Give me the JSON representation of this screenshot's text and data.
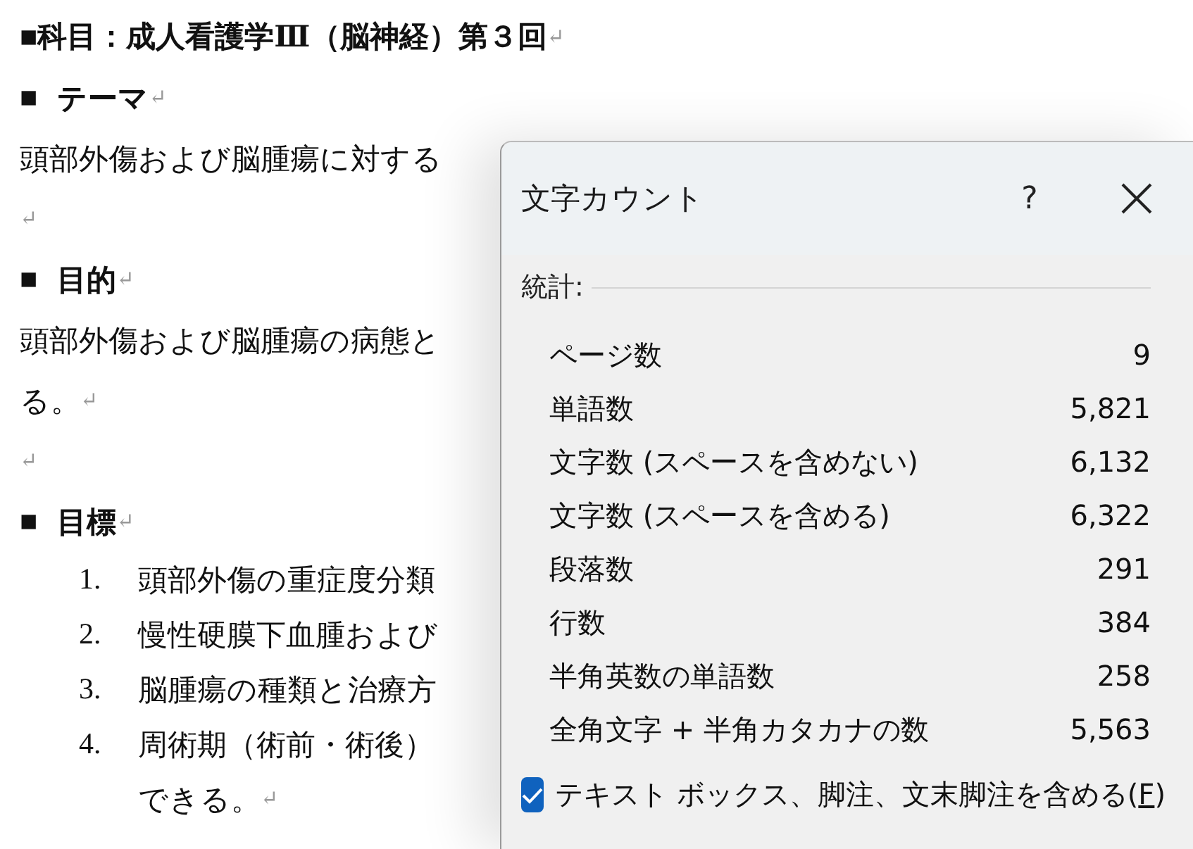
{
  "document": {
    "blocks": [
      {
        "kind": "title",
        "text": "■科目：成人看護学Ⅲ（脳神経）第３回",
        "end_mark": "↵"
      },
      {
        "kind": "heading",
        "bullet": "■",
        "text": "テーマ",
        "end_mark": "↵"
      },
      {
        "kind": "body",
        "text": "頭部外傷および脳腫瘍に対する"
      },
      {
        "kind": "empty",
        "end_mark": "↵"
      },
      {
        "kind": "heading",
        "bullet": "■",
        "text": "目的",
        "end_mark": "↵"
      },
      {
        "kind": "body",
        "text": "頭部外傷および脳腫瘍の病態と"
      },
      {
        "kind": "body",
        "text": "る。",
        "end_mark": "↵"
      },
      {
        "kind": "empty",
        "end_mark": "↵"
      },
      {
        "kind": "heading",
        "bullet": "■",
        "text": "目標",
        "end_mark": "↵"
      },
      {
        "kind": "item",
        "number": "1.",
        "text": "頭部外傷の重症度分類"
      },
      {
        "kind": "item",
        "number": "2.",
        "text": "慢性硬膜下血腫および"
      },
      {
        "kind": "item",
        "number": "3.",
        "text": "脳腫瘍の種類と治療方"
      },
      {
        "kind": "item",
        "number": "4.",
        "text": "周術期（術前・術後）"
      },
      {
        "kind": "continuation",
        "text": "できる。",
        "end_mark": "↵"
      }
    ]
  },
  "dialog": {
    "title": "文字カウント",
    "help": "?",
    "section": "統計:",
    "stats": [
      {
        "label": "ページ数",
        "value": "9"
      },
      {
        "label": "単語数",
        "value": "5,821"
      },
      {
        "label": "文字数 (スペースを含めない)",
        "value": "6,132"
      },
      {
        "label": "文字数 (スペースを含める)",
        "value": "6,322"
      },
      {
        "label": "段落数",
        "value": "291"
      },
      {
        "label": "行数",
        "value": "384"
      },
      {
        "label": "半角英数の単語数",
        "value": "258"
      },
      {
        "label": "全角文字 + 半角カタカナの数",
        "value": "5,563"
      }
    ],
    "include_option": {
      "label": "テキスト ボックス、脚注、文末脚注を含める(",
      "accel": "F",
      "suffix": ")",
      "checked": true
    }
  }
}
